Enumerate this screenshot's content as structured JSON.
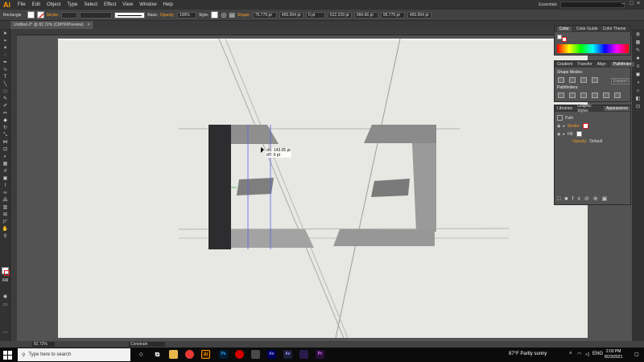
{
  "app": {
    "logo": "Ai"
  },
  "menu": [
    "File",
    "Edit",
    "Object",
    "Type",
    "Select",
    "Effect",
    "View",
    "Window",
    "Help"
  ],
  "workspace": "Essentials",
  "control": {
    "object_type": "Rectangle",
    "stroke_label": "Stroke:",
    "stroke_profile": "Basic",
    "opacity_label": "Opacity:",
    "opacity_value": "100%",
    "style_label": "Style:",
    "shape_label": "Shape:",
    "width_value": "75.779 pt",
    "x_value": "455.004 pt",
    "corner_value": "0 pt",
    "x2_value": "612.229 pt",
    "height_value": "994.66 pt",
    "y_value": "95.775 pt",
    "y2_value": "450.004 pt"
  },
  "document": {
    "tab_title": "Untitled-2* @ 82.72% (CMYK/Preview)",
    "close": "×"
  },
  "canvas": {
    "tooltip_line1": "dX: 143.05 pt",
    "tooltip_line2": "dY: 0 pt"
  },
  "color_panel": {
    "tabs": [
      "Color",
      "Color Guide",
      "Color Theme"
    ]
  },
  "pathfinder_panel": {
    "tabs": [
      "Gradient",
      "Transfor",
      "Align",
      "Pathfinder"
    ],
    "shape_modes_label": "Shape Modes:",
    "expand_label": "Expand",
    "pathfinders_label": "Pathfinders:"
  },
  "appearance_panel": {
    "tabs": [
      "Libraries",
      "Graphic Styles",
      "Appearance"
    ],
    "object_label": "Path",
    "stroke_label": "Stroke:",
    "fill_label": "Fill:",
    "opacity_label": "Opacity:",
    "opacity_value": "Default"
  },
  "status": {
    "zoom": "82.72%",
    "constrain": "Constrain"
  },
  "taskbar": {
    "search_placeholder": "Type here to search",
    "weather": "87°F  Partly sunny",
    "language": "ENG",
    "time": "2:03 PM",
    "date": "8/23/2021"
  },
  "colors": {
    "accent": "#f59a23",
    "taskbar": "#0b0b0b",
    "dark_ui": "#323232",
    "artboard_paper": "#e7e7e4",
    "selection_bar": "#2d2d2f"
  }
}
